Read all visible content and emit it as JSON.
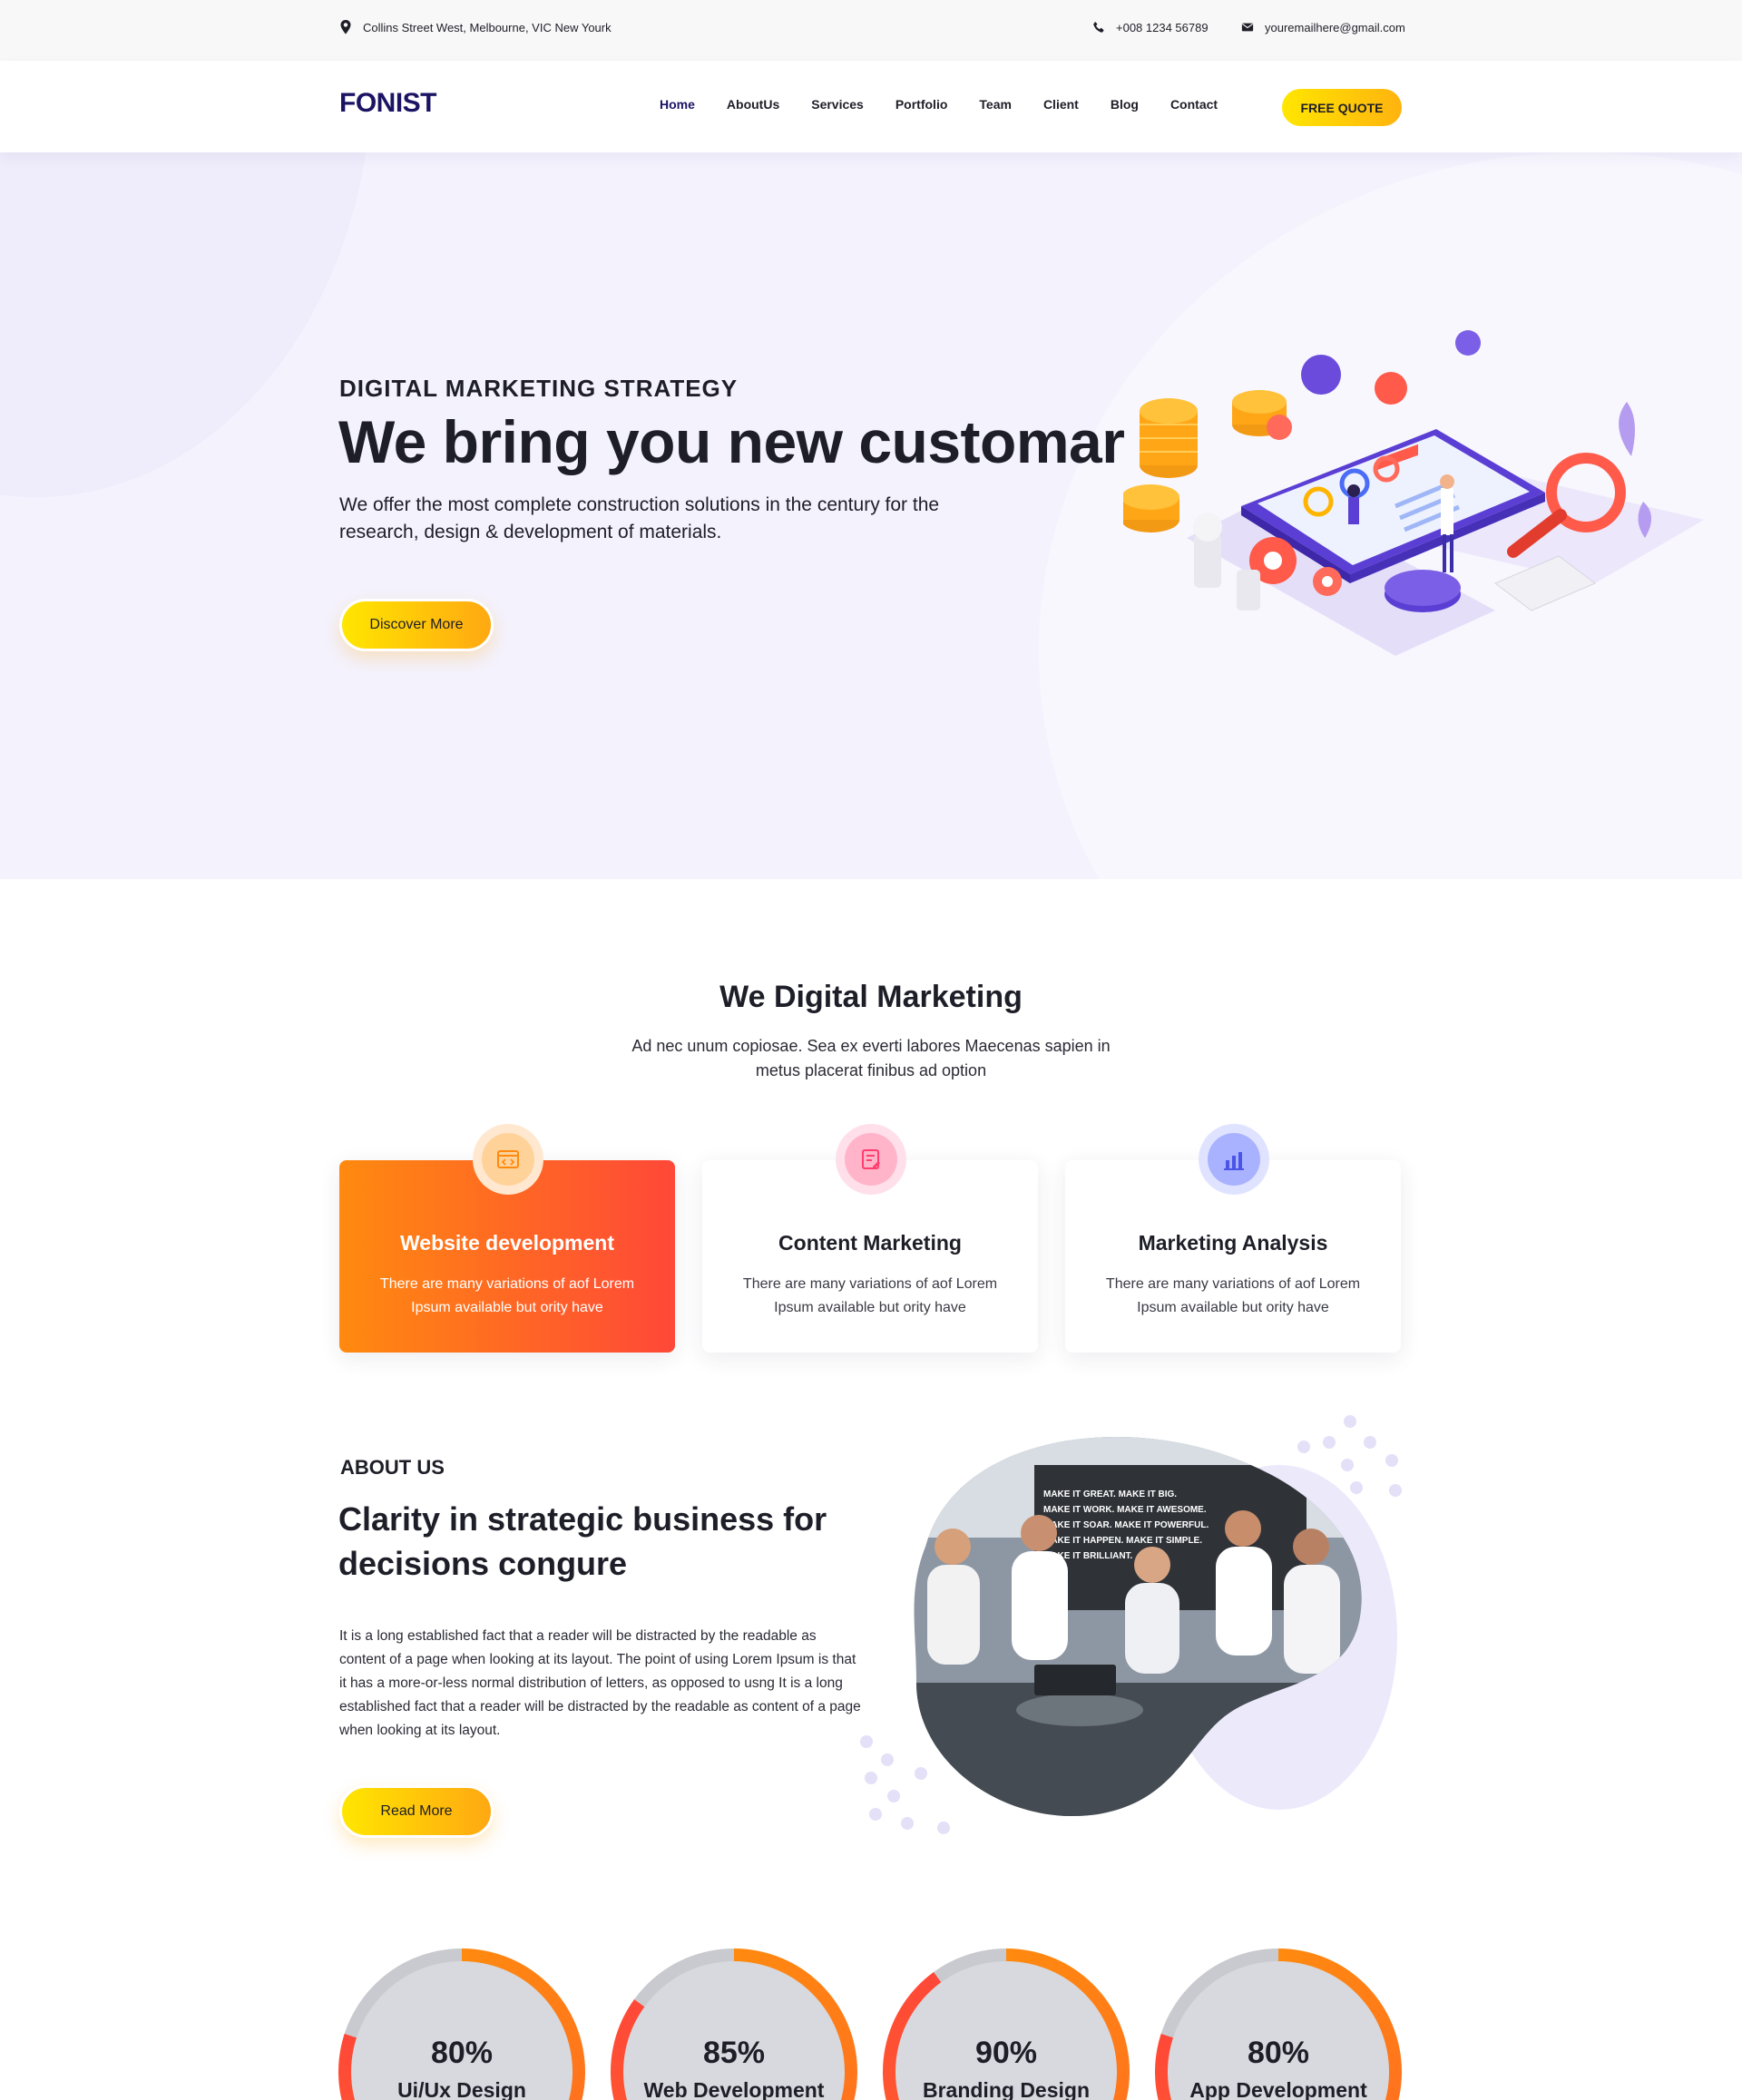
{
  "topbar": {
    "address": "Collins Street West, Melbourne, VIC New Yourk",
    "phone": "+008 1234 56789",
    "email": "youremailhere@gmail.com"
  },
  "nav": {
    "logo": "FONIST",
    "items": [
      {
        "label": "Home"
      },
      {
        "label": "AboutUs"
      },
      {
        "label": "Services"
      },
      {
        "label": "Portfolio"
      },
      {
        "label": "Team"
      },
      {
        "label": "Client"
      },
      {
        "label": "Blog"
      },
      {
        "label": "Contact"
      }
    ],
    "active": "Home",
    "cta": "FREE QUOTE"
  },
  "hero": {
    "kicker": "DIGITAL MARKETING STRATEGY",
    "title": "We bring you new customar",
    "lead": "We offer the most complete construction solutions in the century for the research, design & development of materials.",
    "button": "Discover More"
  },
  "services": {
    "title": "We Digital Marketing",
    "subtitle": "Ad nec unum copiosae. Sea ex everti labores Maecenas sapien in metus placerat finibus ad option",
    "cards": [
      {
        "title": "Website development",
        "text": "There are many variations of aof Lorem Ipsum available but ority have",
        "icon": "code-window-icon"
      },
      {
        "title": "Content Marketing",
        "text": "There are many variations of aof Lorem Ipsum available but ority have",
        "icon": "edit-document-icon"
      },
      {
        "title": "Marketing Analysis",
        "text": "There are many variations of aof Lorem Ipsum available but ority have",
        "icon": "bar-chart-icon"
      }
    ]
  },
  "about": {
    "kicker": "ABOUT US",
    "title": "Clarity in strategic business for decisions congure",
    "text": "It is a long established fact that a reader will be distracted by the readable as content of a page when looking at its layout. The point of using Lorem Ipsum is that it has a more-or-less normal distribution of letters, as opposed to usng It is a long established fact that a reader will be distracted by the readable as content of a page when looking at its layout.",
    "button": "Read More",
    "photo_wall_text": "MAKE IT GREAT. MAKE IT BIG. MAKE IT WORK. MAKE IT AWESOME. MAKE IT SOAR. MAKE IT POWERFUL. MAKE IT HAPPEN. MAKE IT SIMPLE. MAKE IT BRILLIANT."
  },
  "skills": [
    {
      "percent": "80%",
      "label": "Ui/Ux Design",
      "value": 0.8
    },
    {
      "percent": "85%",
      "label": "Web Development",
      "value": 0.85
    },
    {
      "percent": "90%",
      "label": "Branding Design",
      "value": 0.9
    },
    {
      "percent": "80%",
      "label": "App Development",
      "value": 0.8
    }
  ],
  "colors": {
    "brand_navy": "#1b1464",
    "cta_yellow": "#ffe600",
    "cta_orange": "#ffa812",
    "card_orange": "#ff8a0f",
    "card_red": "#ff4838",
    "hero_bg": "#f4f2fd",
    "ring_track": "#c8cacf"
  }
}
